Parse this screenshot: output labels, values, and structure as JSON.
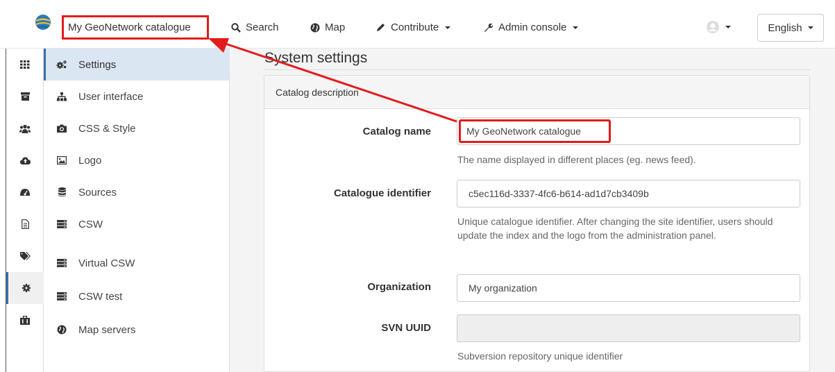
{
  "navbar": {
    "logo_icon": "geonetwork-globe-icon",
    "catalog_title": "My GeoNetwork catalogue",
    "items": [
      {
        "label": "Search",
        "icon": "search-icon"
      },
      {
        "label": "Map",
        "icon": "globe-icon"
      },
      {
        "label": "Contribute",
        "icon": "pencil-icon"
      },
      {
        "label": "Admin console",
        "icon": "wrench-icon"
      }
    ],
    "user_icon": "user-icon",
    "language": "English"
  },
  "rail": {
    "items": [
      "grid-icon",
      "archive-icon",
      "users-icon",
      "cloud-upload-icon",
      "dashboard-icon",
      "file-icon",
      "tags-icon",
      "gear-icon",
      "briefcase-icon"
    ],
    "active_index": 7
  },
  "menu": {
    "items": [
      {
        "label": "Settings",
        "icon": "cogs-icon"
      },
      {
        "label": "User interface",
        "icon": "sitemap-icon"
      },
      {
        "label": "CSS & Style",
        "icon": "camera-icon"
      },
      {
        "label": "Logo",
        "icon": "picture-icon"
      },
      {
        "label": "Sources",
        "icon": "database-icon"
      },
      {
        "label": "CSW",
        "icon": "server-icon"
      },
      {
        "label": "Virtual CSW",
        "icon": "server-icon"
      },
      {
        "label": "CSW test",
        "icon": "server-icon"
      },
      {
        "label": "Map servers",
        "icon": "globe-icon"
      }
    ],
    "active_index": 0
  },
  "main": {
    "title": "System settings",
    "panel_title": "Catalog description",
    "fields": [
      {
        "label": "Catalog name",
        "value": "My GeoNetwork catalogue",
        "help": "The name displayed in different places (eg. news feed)."
      },
      {
        "label": "Catalogue identifier",
        "value": "c5ec116d-3337-4fc6-b614-ad1d7cb3409b",
        "help": "Unique catalogue identifier. After changing the site identifier, users should update the index and the logo from the administration panel."
      },
      {
        "label": "Organization",
        "value": "My organization",
        "help": ""
      },
      {
        "label": "SVN UUID",
        "value": "",
        "help": "Subversion repository unique identifier"
      }
    ]
  },
  "colors": {
    "annotation": "#e31b1b",
    "accent": "#3a6fa8",
    "active_menu_bg": "#dbe6f3"
  }
}
